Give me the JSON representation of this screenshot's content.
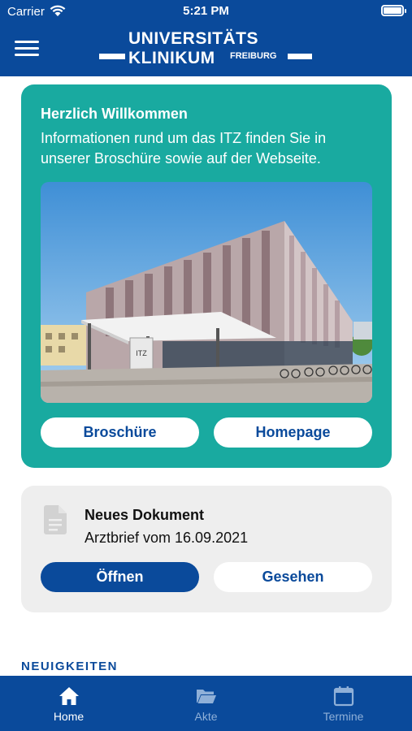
{
  "status_bar": {
    "carrier": "Carrier",
    "time": "5:21 PM"
  },
  "header": {
    "logo_line1": "UNIVERSITÄTS",
    "logo_line2": "KLINIKUM",
    "logo_sub": "FREIBURG"
  },
  "welcome": {
    "title": "Herzlich Willkommen",
    "text": "Informationen rund um das ITZ finden Sie in unserer Broschüre sowie auf der Webseite.",
    "sign_text": "ITZ",
    "brochure_label": "Broschüre",
    "homepage_label": "Homepage"
  },
  "document": {
    "title": "Neues Dokument",
    "subtitle": "Arztbrief vom 16.09.2021",
    "open_label": "Öffnen",
    "seen_label": "Gesehen"
  },
  "news": {
    "heading": "NEUIGKEITEN"
  },
  "tabs": [
    {
      "label": "Home",
      "icon": "home-icon",
      "active": true
    },
    {
      "label": "Akte",
      "icon": "folder-icon",
      "active": false
    },
    {
      "label": "Termine",
      "icon": "calendar-icon",
      "active": false
    }
  ],
  "colors": {
    "brand_blue": "#0a4a9b",
    "teal": "#19aaa0",
    "card_grey": "#eeeeee",
    "inactive_tab": "#8fb0d8"
  }
}
